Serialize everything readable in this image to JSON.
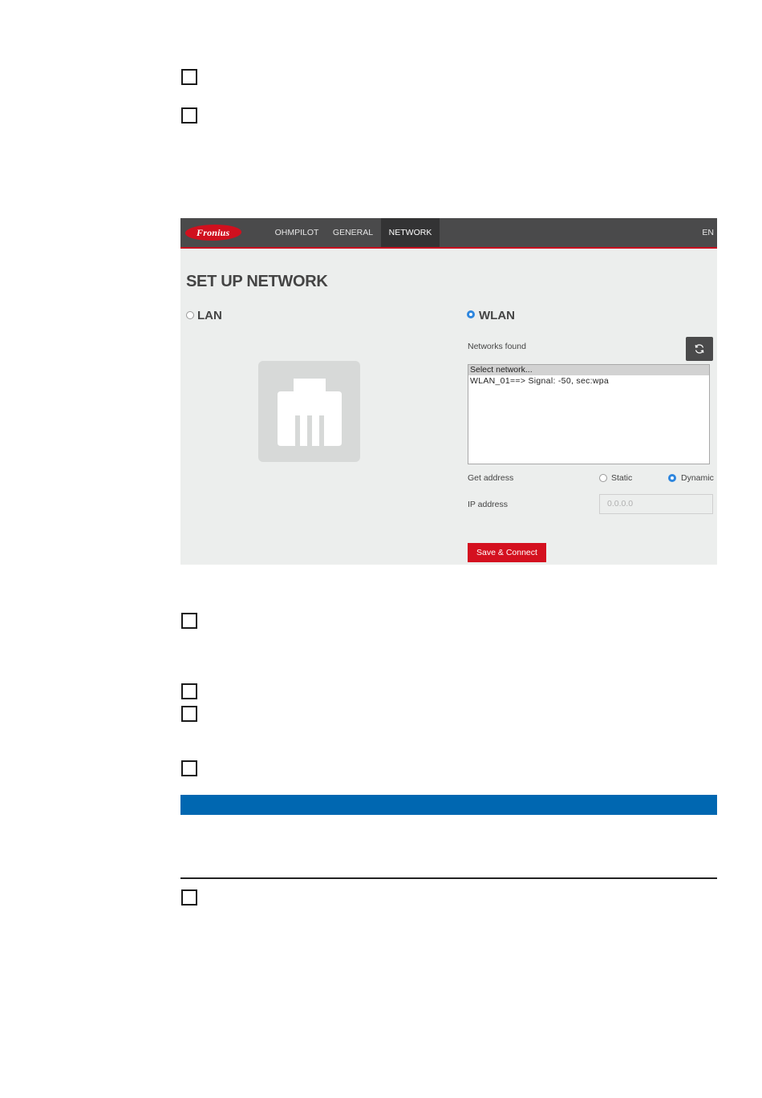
{
  "nav": {
    "logo": "Fronius",
    "items": [
      {
        "label": "OHMPILOT"
      },
      {
        "label": "GENERAL"
      },
      {
        "label": "NETWORK"
      }
    ],
    "language": "EN"
  },
  "page": {
    "title": "SET UP NETWORK",
    "lan_label": "LAN",
    "wlan_label": "WLAN",
    "selected_mode": "WLAN"
  },
  "wlan": {
    "networks_found_label": "Networks found",
    "network_list": {
      "placeholder": "Select network...",
      "items": [
        "WLAN_01==> Signal: -50, sec:wpa"
      ]
    },
    "get_address_label": "Get address",
    "address_options": [
      "Static",
      "Dynamic"
    ],
    "address_selected": "Dynamic",
    "ip_address_label": "IP address",
    "ip_address_placeholder": "0.0.0.0",
    "save_button": "Save & Connect"
  },
  "colors": {
    "brand_red": "#d4101f",
    "nav_bg": "#4a4a4b",
    "radio_blue": "#2e86de",
    "note_bar_blue": "#0067b1"
  }
}
